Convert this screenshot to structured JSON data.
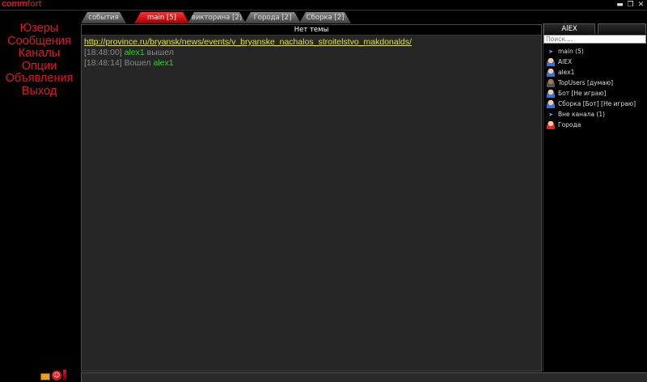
{
  "app": {
    "logo_part1": "comm",
    "logo_part2": "fort"
  },
  "window_controls": {
    "minimize": "▬",
    "restore": "❐",
    "close": "✕"
  },
  "menu": [
    {
      "label": "Юзеры"
    },
    {
      "label": "Сообщения"
    },
    {
      "label": "Каналы"
    },
    {
      "label": "Опции"
    },
    {
      "label": "Объявления"
    },
    {
      "label": "Выход"
    }
  ],
  "tabs": [
    {
      "label": "события"
    },
    {
      "label": "main [5]"
    },
    {
      "label": "викторина [2]"
    },
    {
      "label": "Города [2]"
    },
    {
      "label": "Сборка [2]"
    }
  ],
  "chat": {
    "topic": "Нет темы",
    "link": "http://province.ru/bryansk/news/events/v_bryanske_nachalos_stroitelstvo_makdonalds/",
    "messages": [
      {
        "time": "[18:48:00]",
        "nick": "alex1",
        "text": "вышел"
      },
      {
        "time": "[18:48:14]",
        "text": "Вошел",
        "nick": "alex1"
      }
    ]
  },
  "users_panel": {
    "tab1": "AlEX",
    "tab2": "",
    "search_placeholder": "Поиск....",
    "items": [
      {
        "label": "main (5)",
        "icon": "channel-icon"
      },
      {
        "label": "AlEX",
        "icon": "user-icon"
      },
      {
        "label": "alex1",
        "icon": "user-icon"
      },
      {
        "label": "TopUsers [думаю]",
        "icon": "user-away-icon"
      },
      {
        "label": "Бот [Не играю]",
        "icon": "user-icon"
      },
      {
        "label": "Сборка [Бот] [Не играю]",
        "icon": "user-icon"
      },
      {
        "label": "Вне канала (1)",
        "icon": "channel-icon"
      },
      {
        "label": "Городa",
        "icon": "user-red-icon"
      }
    ]
  },
  "colors": {
    "menu_red": "#e0152a",
    "link_yellow": "#e6e61a",
    "nick_green": "#2ed12e",
    "timestamp_grey": "#8a8a8a"
  }
}
